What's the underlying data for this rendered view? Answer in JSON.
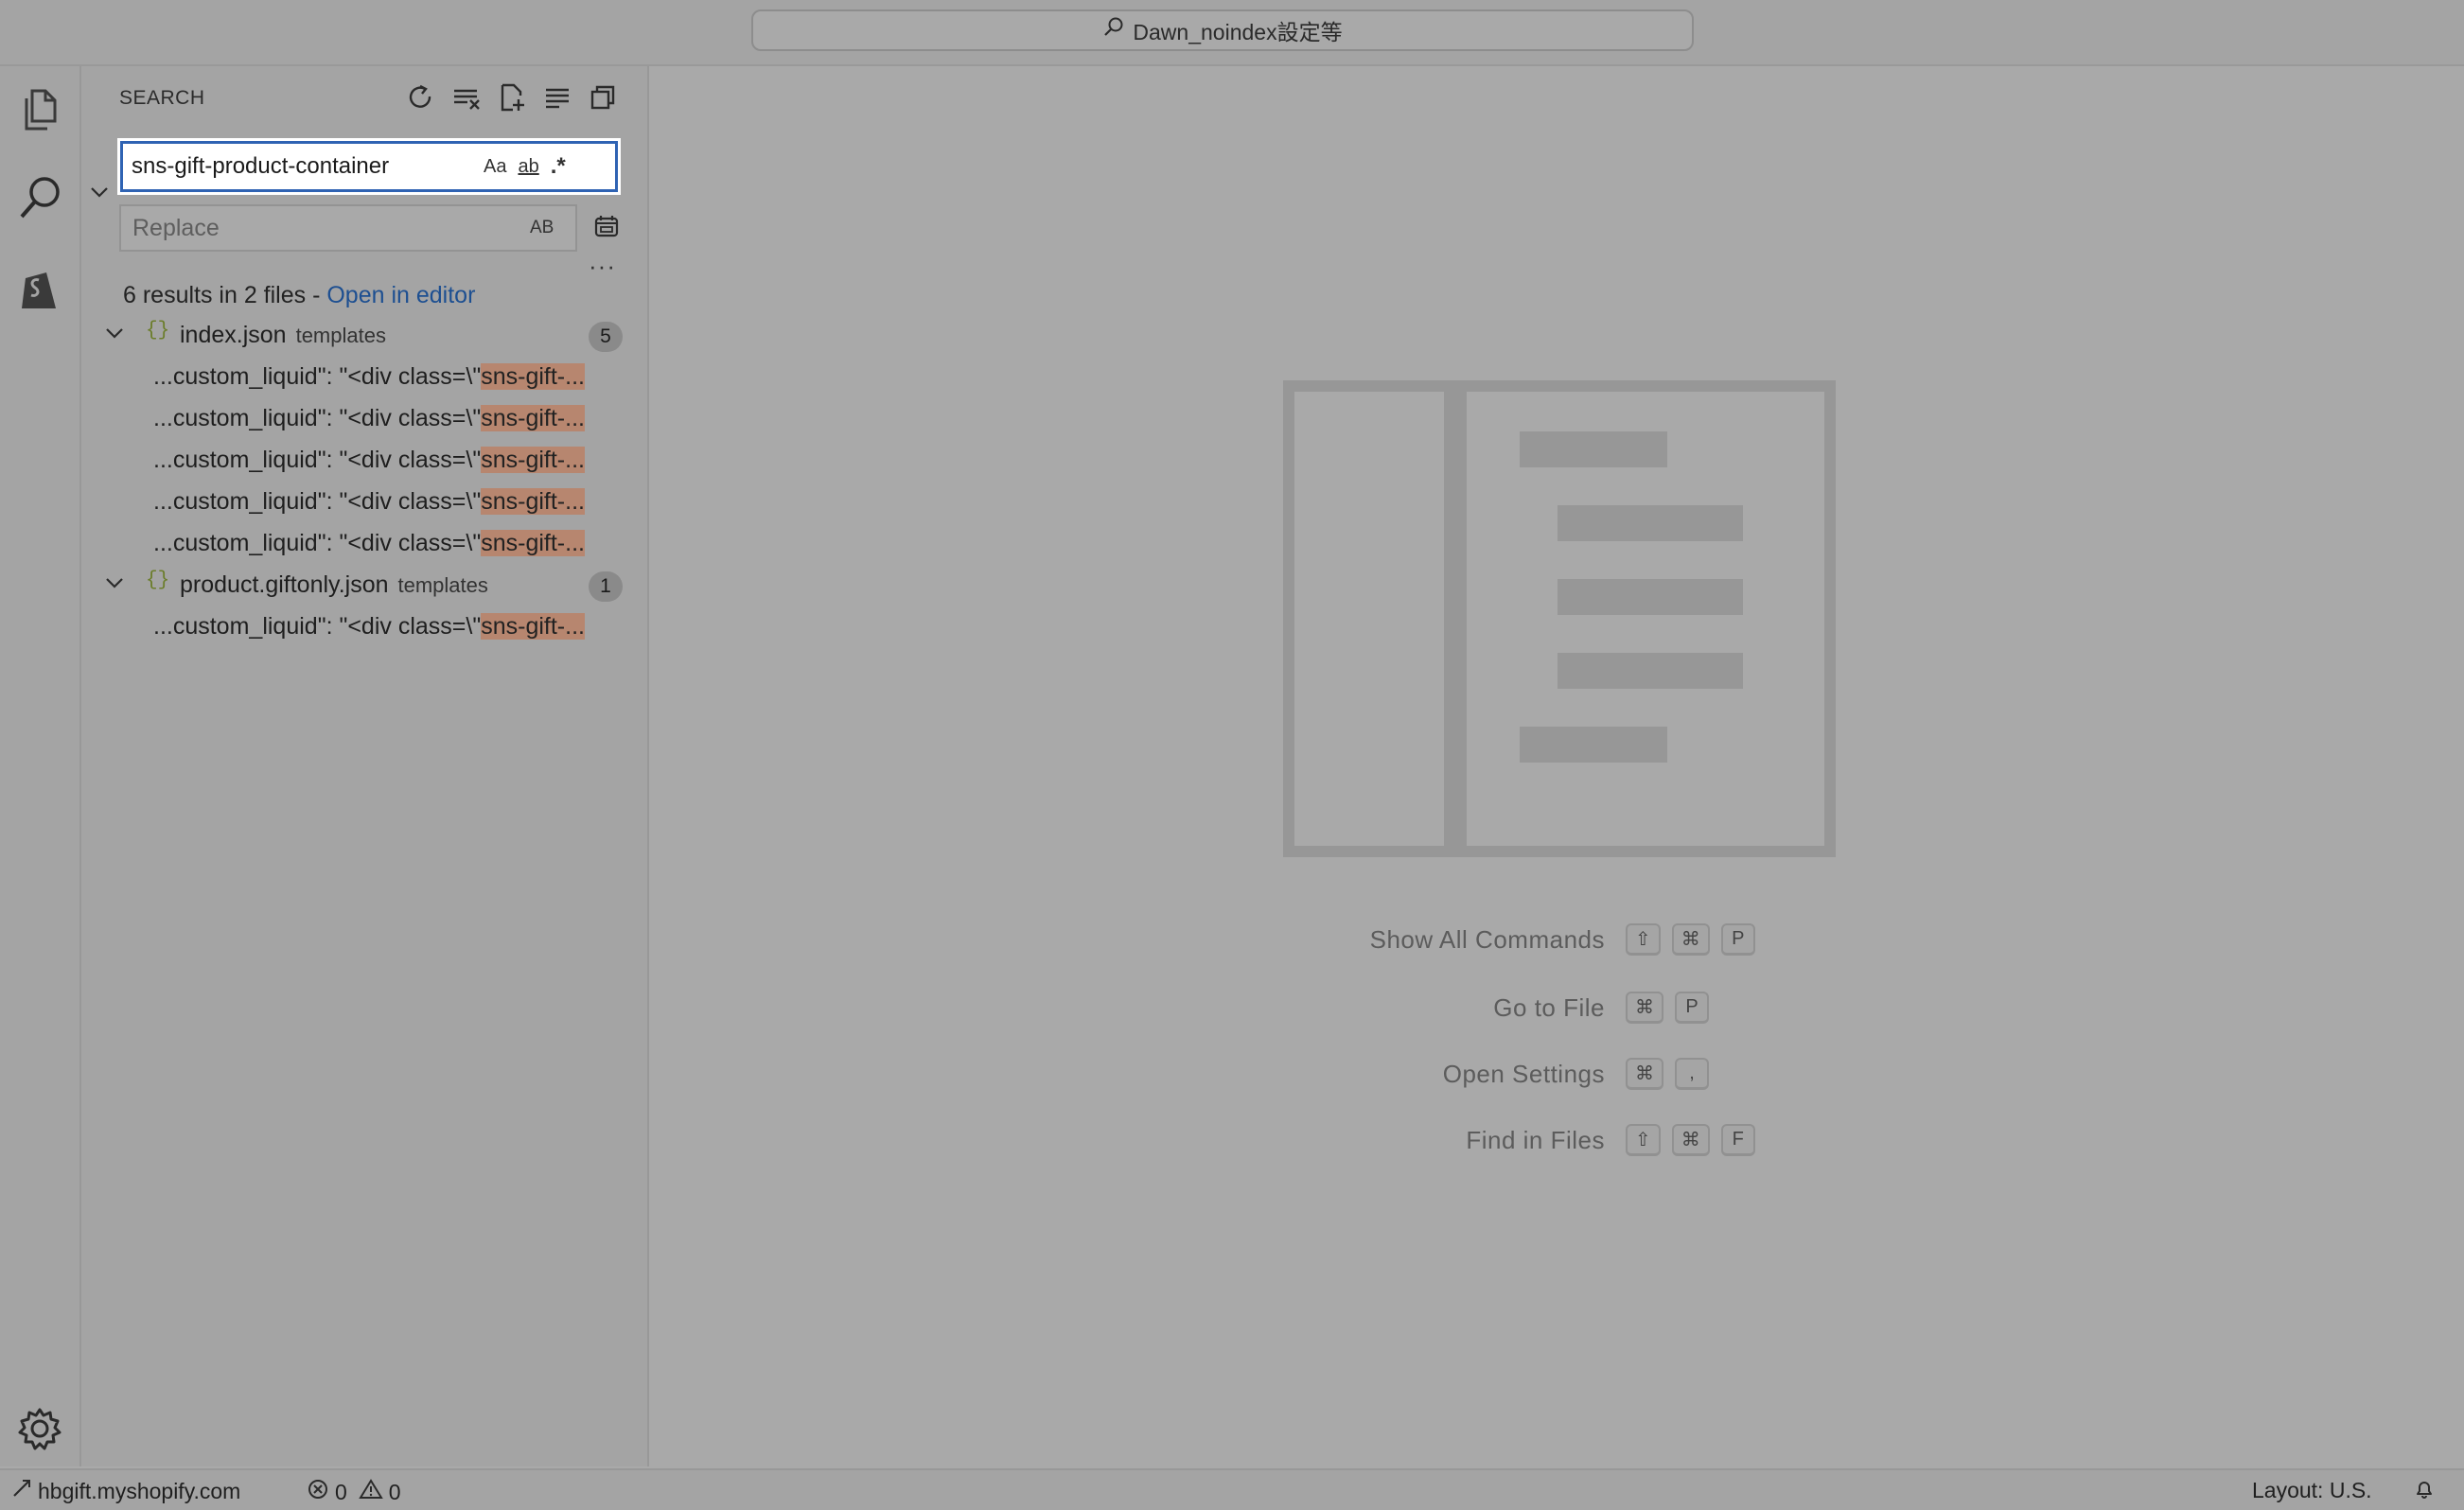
{
  "title_bar": {
    "search_text": "Dawn_noindex設定等"
  },
  "sidebar": {
    "title": "SEARCH",
    "search_value": "sns-gift-product-container",
    "options": {
      "match_case": "Aa",
      "whole_word": "ab",
      "regex": ".*"
    },
    "replace_placeholder": "Replace",
    "preserve_case": "AB",
    "more": "···",
    "summary_text": "6 results in 2 files - ",
    "open_in_editor": "Open in editor",
    "files": [
      {
        "name": "index.json",
        "dir": "templates",
        "count": "5",
        "matches": [
          {
            "before": "...custom_liquid\": \"<div class=\\\"",
            "match": "sns-gift-..."
          },
          {
            "before": "...custom_liquid\": \"<div class=\\\"",
            "match": "sns-gift-..."
          },
          {
            "before": "...custom_liquid\": \"<div class=\\\"",
            "match": "sns-gift-..."
          },
          {
            "before": "...custom_liquid\": \"<div class=\\\"",
            "match": "sns-gift-..."
          },
          {
            "before": "...custom_liquid\": \"<div class=\\\"",
            "match": "sns-gift-..."
          }
        ]
      },
      {
        "name": "product.giftonly.json",
        "dir": "templates",
        "count": "1",
        "matches": [
          {
            "before": "...custom_liquid\": \"<div class=\\\"",
            "match": "sns-gift-..."
          }
        ]
      }
    ]
  },
  "editor": {
    "shortcuts": [
      {
        "label": "Show All Commands",
        "keys": [
          "⇧",
          "⌘",
          "P"
        ]
      },
      {
        "label": "Go to File",
        "keys": [
          "⌘",
          "P"
        ]
      },
      {
        "label": "Open Settings",
        "keys": [
          "⌘",
          ","
        ]
      },
      {
        "label": "Find in Files",
        "keys": [
          "⇧",
          "⌘",
          "F"
        ]
      }
    ]
  },
  "status_bar": {
    "remote": "hbgift.myshopify.com",
    "errors": "0",
    "warnings": "0",
    "layout": "Layout: U.S."
  },
  "icons": {
    "activity": [
      "explorer-icon",
      "search-icon",
      "shopify-icon",
      "settings-gear-icon"
    ],
    "sidebar_actions": [
      "refresh-icon",
      "clear-results-icon",
      "new-search-editor-icon",
      "collapse-all-icon",
      "view-as-tree-icon"
    ]
  },
  "colors": {
    "match_highlight": "#b7866f",
    "focus_border": "#2f63b3",
    "link": "#1d4f91"
  }
}
